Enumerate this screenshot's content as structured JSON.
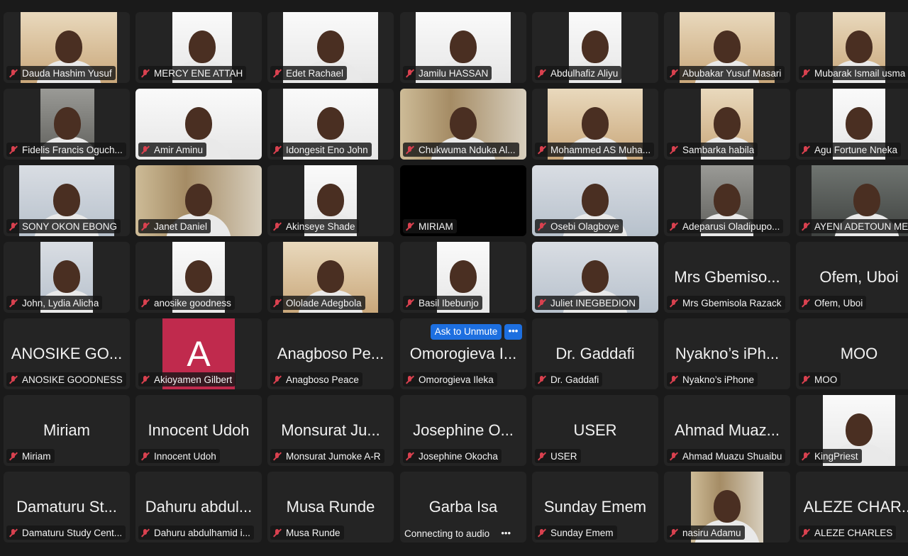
{
  "controls": {
    "ask_to_unmute_label": "Ask to Unmute",
    "more_label": "•••",
    "connecting_label": "Connecting to audio",
    "connecting_dots": "•••"
  },
  "participants": [
    {
      "label": "Dauda Hashim Yusuf",
      "tile": "video",
      "bg": "warm"
    },
    {
      "label": "MERCY ENE ATTAH",
      "tile": "video",
      "bg": "white"
    },
    {
      "label": "Edet Rachael",
      "tile": "video",
      "bg": "white"
    },
    {
      "label": "Jamilu HASSAN",
      "tile": "video",
      "bg": "white"
    },
    {
      "label": "Abdulhafiz Aliyu",
      "tile": "video",
      "bg": "white"
    },
    {
      "label": "Abubakar Yusuf Masari",
      "tile": "video",
      "bg": "warm"
    },
    {
      "label": "Mubarak Ismail usma",
      "tile": "video",
      "bg": "warm"
    },
    {
      "label": "Fidelis Francis Oguch...",
      "tile": "video",
      "bg": "gray"
    },
    {
      "label": "Amir Aminu",
      "tile": "video",
      "bg": "white"
    },
    {
      "label": "Idongesit  Eno  John",
      "tile": "video",
      "bg": "white"
    },
    {
      "label": "Chukwuma Nduka Al...",
      "tile": "video",
      "bg": "shelf"
    },
    {
      "label": "Mohammed AS Muha...",
      "tile": "video",
      "bg": "warm"
    },
    {
      "label": "Sambarka habila",
      "tile": "video",
      "bg": "warm"
    },
    {
      "label": "Agu Fortune Nneka",
      "tile": "video",
      "bg": "white"
    },
    {
      "label": "SONY OKON EBONG",
      "tile": "video",
      "bg": "blue"
    },
    {
      "label": "Janet Daniel",
      "tile": "video",
      "bg": "shelf"
    },
    {
      "label": "Akinseye Shade",
      "tile": "video",
      "bg": "white"
    },
    {
      "label": "MIRIAM",
      "tile": "black"
    },
    {
      "label": "Osebi Olagboye",
      "tile": "video",
      "bg": "blue"
    },
    {
      "label": "Adeparusi Oladipupo...",
      "tile": "video",
      "bg": "gray"
    },
    {
      "label": "AYENI ADETOUN ME",
      "tile": "video",
      "bg": "dark"
    },
    {
      "label": "John, Lydia Alicha",
      "tile": "video",
      "bg": "blue"
    },
    {
      "label": "anosike goodness",
      "tile": "video",
      "bg": "white"
    },
    {
      "label": "Ololade Adegbola",
      "tile": "video",
      "bg": "warm"
    },
    {
      "label": "Basil Ibebunjo",
      "tile": "video",
      "bg": "white"
    },
    {
      "label": "Juliet INEGBEDION",
      "tile": "video",
      "bg": "blue"
    },
    {
      "label": "Mrs Gbemisola Razack",
      "tile": "name",
      "big": "Mrs Gbemiso..."
    },
    {
      "label": "Ofem, Uboi",
      "tile": "name",
      "big": "Ofem, Uboi"
    },
    {
      "label": "ANOSIKE GOODNESS",
      "tile": "name",
      "big": "ANOSIKE GO..."
    },
    {
      "label": "Akioyamen Gilbert",
      "tile": "avatar",
      "letter": "A"
    },
    {
      "label": "Anagboso Peace",
      "tile": "name",
      "big": "Anagboso Pe..."
    },
    {
      "label": "Omorogieva Ileka",
      "tile": "name",
      "big": "Omorogieva I..."
    },
    {
      "label": "Dr. Gaddafi",
      "tile": "name",
      "big": "Dr. Gaddafi"
    },
    {
      "label": "Nyakno’s iPhone",
      "tile": "name",
      "big": "Nyakno’s iPh..."
    },
    {
      "label": "MOO",
      "tile": "name",
      "big": "MOO"
    },
    {
      "label": "Miriam",
      "tile": "name",
      "big": "Miriam"
    },
    {
      "label": "Innocent Udoh",
      "tile": "name",
      "big": "Innocent Udoh"
    },
    {
      "label": "Monsurat Jumoke A-R",
      "tile": "name",
      "big": "Monsurat Ju..."
    },
    {
      "label": "Josephine Okocha",
      "tile": "name",
      "big": "Josephine O..."
    },
    {
      "label": "USER",
      "tile": "name",
      "big": "USER"
    },
    {
      "label": "Ahmad Muazu Shuaibu",
      "tile": "name",
      "big": "Ahmad Muaz..."
    },
    {
      "label": "KingPriest",
      "tile": "video",
      "bg": "white"
    },
    {
      "label": "Damaturu Study Cent...",
      "tile": "name",
      "big": "Damaturu St..."
    },
    {
      "label": "Dahuru abdulhamid i...",
      "tile": "name",
      "big": "Dahuru abdul..."
    },
    {
      "label": "Musa Runde",
      "tile": "name",
      "big": "Musa Runde"
    },
    {
      "label": "",
      "tile": "connecting",
      "big": "Garba Isa"
    },
    {
      "label": "Sunday Emem",
      "tile": "name",
      "big": "Sunday Emem"
    },
    {
      "label": "nasiru Adamu",
      "tile": "video",
      "bg": "shelf"
    },
    {
      "label": "ALEZE CHARLES",
      "tile": "name",
      "big": "ALEZE CHAR..."
    }
  ]
}
